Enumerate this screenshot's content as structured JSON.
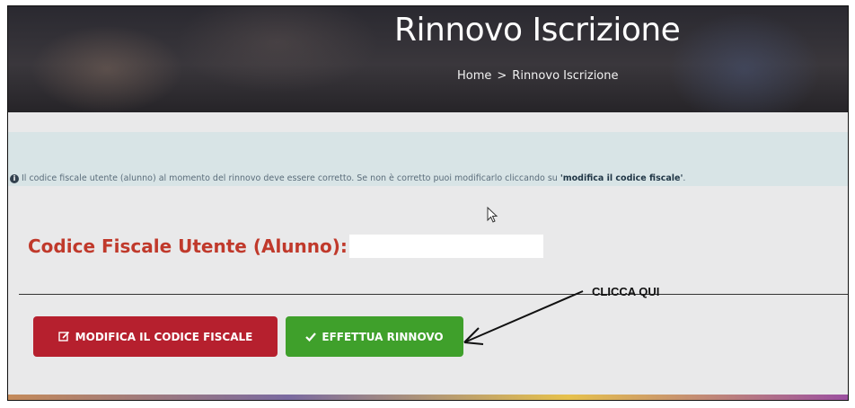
{
  "header": {
    "title": "Rinnovo Iscrizione",
    "breadcrumb_home": "Home",
    "breadcrumb_sep": ">",
    "breadcrumb_current": "Rinnovo Iscrizione"
  },
  "info": {
    "text": "Il codice fiscale utente (alunno) al momento del rinnovo deve essere corretto. Se non è corretto puoi modificarlo cliccando su ",
    "emphasis": "'modifica il codice fiscale'",
    "icon": "info-circle-icon"
  },
  "form": {
    "label": "Codice Fiscale Utente (Alunno):",
    "value": ""
  },
  "annotation": {
    "text": "CLICCA QUI"
  },
  "buttons": {
    "edit_label": "MODIFICA IL CODICE FISCALE",
    "edit_icon": "edit-icon",
    "renew_label": "EFFETTUA RINNOVO",
    "renew_icon": "check-icon"
  },
  "colors": {
    "label_red": "#c0392b",
    "edit_button": "#b6202e",
    "renew_button": "#3fa02b",
    "info_bg": "#d8e4e6"
  }
}
